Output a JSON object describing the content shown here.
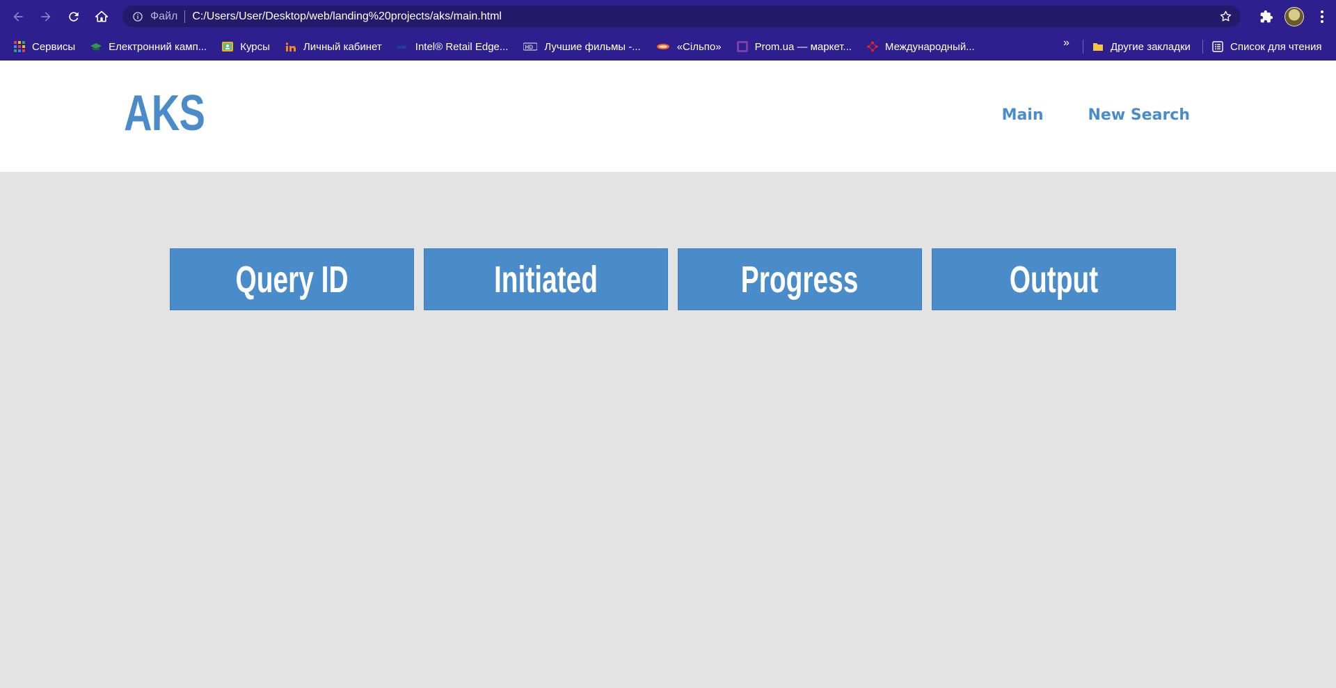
{
  "browser": {
    "scheme_label": "Файл",
    "url": "C:/Users/User/Desktop/web/landing%20projects/aks/main.html",
    "bookmarks": [
      {
        "label": "Сервисы",
        "icon": "apps-grid-icon",
        "color": "#e9453a"
      },
      {
        "label": "Електронний камп...",
        "icon": "graduation-cap-icon",
        "color": "#2f9a4c"
      },
      {
        "label": "Курсы",
        "icon": "classroom-icon",
        "color": "#f4b400"
      },
      {
        "label": "Личный кабинет",
        "icon": "in-logo-icon",
        "color": "#f08a1d"
      },
      {
        "label": "Intel® Retail Edge...",
        "icon": "intel-logo-icon",
        "color": "#0071c5"
      },
      {
        "label": "Лучшие фильмы -...",
        "icon": "hd-icon",
        "color": "#cccccc"
      },
      {
        "label": "«Сільпо»",
        "icon": "silpo-logo-icon",
        "color": "#f26522"
      },
      {
        "label": "Prom.ua — маркет...",
        "icon": "prom-logo-icon",
        "color": "#7b3ea8"
      },
      {
        "label": "Международный...",
        "icon": "network-icon",
        "color": "#d9262c"
      }
    ],
    "more_label": "»",
    "other_bookmarks": "Другие закладки",
    "reading_list": "Список для чтения"
  },
  "site": {
    "logo": "AKS",
    "nav": [
      "Main",
      "New Search"
    ]
  },
  "table": {
    "headers": [
      "Query ID",
      "Initiated",
      "Progress",
      "Output"
    ]
  },
  "colors": {
    "accent": "#4a8cca",
    "chrome": "#2e1f8e",
    "page_bg": "#e3e3e3"
  }
}
